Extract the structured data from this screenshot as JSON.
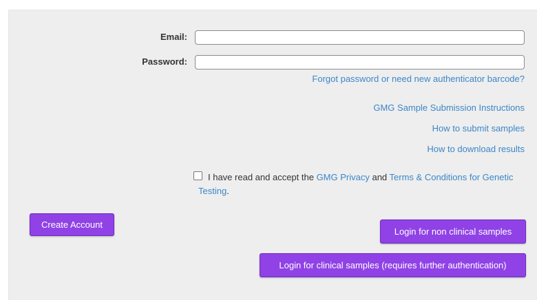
{
  "form": {
    "email_label": "Email:",
    "email_value": "",
    "password_label": "Password:",
    "password_value": "",
    "forgot_link": "Forgot password or need new authenticator barcode?"
  },
  "links": {
    "instructions": "GMG Sample Submission Instructions",
    "how_submit": "How to submit samples",
    "how_download": "How to download results"
  },
  "terms": {
    "checked": false,
    "prefix": "I have read and accept the ",
    "privacy_link": "GMG Privacy",
    "middle": " and ",
    "terms_link": "Terms & Conditions for Genetic Testing",
    "suffix": "."
  },
  "buttons": {
    "create_account": "Create Account",
    "login_non_clinical": "Login for non clinical samples",
    "login_clinical": "Login for clinical samples (requires further authentication)"
  },
  "colors": {
    "accent": "#9042e6",
    "link": "#3b86c8",
    "panel_bg": "#eeeeee"
  }
}
